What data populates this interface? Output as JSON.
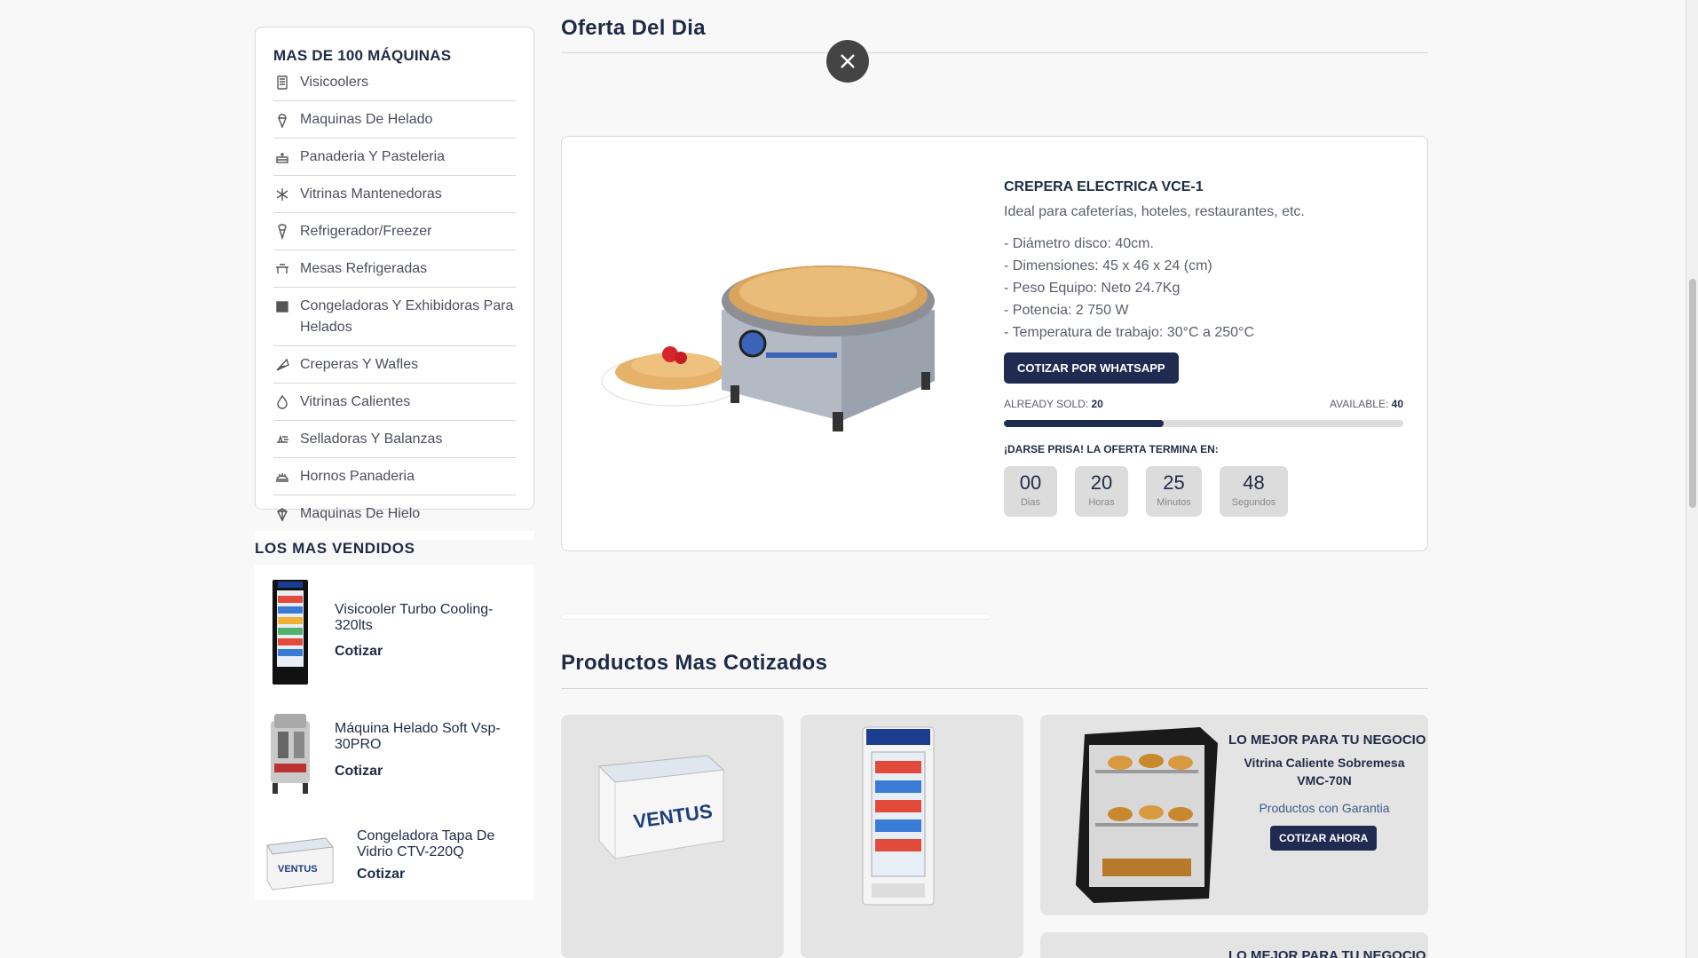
{
  "sidebar": {
    "title": "MAS DE 100 MÁQUINAS",
    "items": [
      {
        "label": "Visicoolers",
        "icon": "visicooler-icon"
      },
      {
        "label": "Maquinas De Helado",
        "icon": "ice-cream-icon"
      },
      {
        "label": "Panaderia Y Pasteleria",
        "icon": "cake-icon"
      },
      {
        "label": "Vitrinas Mantenedoras",
        "icon": "snowflake-icon"
      },
      {
        "label": "Refrigerador/Freezer",
        "icon": "freezer-icon"
      },
      {
        "label": "Mesas Refrigeradas",
        "icon": "table-icon"
      },
      {
        "label": "Congeladoras Y Exhibidoras Para Helados",
        "icon": "chest-freezer-icon"
      },
      {
        "label": "Creperas Y Wafles",
        "icon": "crepe-icon"
      },
      {
        "label": "Vitrinas Calientes",
        "icon": "flame-icon"
      },
      {
        "label": "Selladoras Y Balanzas",
        "icon": "scale-icon"
      },
      {
        "label": "Hornos Panaderia",
        "icon": "oven-icon"
      },
      {
        "label": "Maquinas De Hielo",
        "icon": "ice-icon"
      }
    ]
  },
  "best_sellers": {
    "title": "LOS MAS VENDIDOS",
    "items": [
      {
        "name": "Visicooler Turbo Cooling-320lts",
        "cta": "Cotizar"
      },
      {
        "name": "Máquina Helado Soft Vsp-30PRO",
        "cta": "Cotizar"
      },
      {
        "name": "Congeladora Tapa De Vidrio CTV-220Q",
        "cta": "Cotizar"
      }
    ]
  },
  "offer": {
    "section_title": "Oferta Del Dia",
    "product_name": "CREPERA ELECTRICA VCE-1",
    "subtitle": "Ideal para cafeterías, hoteles, restaurantes, etc.",
    "specs": [
      "- Diámetro disco: 40cm.",
      "- Dimensiones: 45 x 46 x 24 (cm)",
      "- Peso Equipo: Neto 24.7Kg",
      "- Potencia: 2 750 W",
      "- Temperatura de trabajo: 30°C a 250°C"
    ],
    "cta": "COTIZAR POR WHATSAPP",
    "sold_label": "ALREADY SOLD:",
    "sold_value": "20",
    "available_label": "AVAILABLE:",
    "available_value": "40",
    "sold_fraction": 0.4,
    "hurry": "¡DARSE PRISA! LA OFERTA TERMINA EN:",
    "timer": [
      {
        "value": "00",
        "label": "Dias"
      },
      {
        "value": "20",
        "label": "Horas"
      },
      {
        "value": "25",
        "label": "Minutos"
      },
      {
        "value": "48",
        "label": "Segundos"
      }
    ]
  },
  "products": {
    "section_title": "Productos Mas Cotizados",
    "brand": "VENTUS",
    "promo": {
      "title": "LO MEJOR PARA TU NEGOCIO",
      "name": "Vitrina Caliente Sobremesa VMC-70N",
      "note": "Productos con Garantia",
      "cta": "COTIZAR AHORA"
    },
    "promo2_title": "LO MEJOR PARA TU NEGOCIO"
  },
  "colors": {
    "brand_dark": "#1f2b50",
    "text": "#1f2b46",
    "muted": "#5a5f6b"
  }
}
